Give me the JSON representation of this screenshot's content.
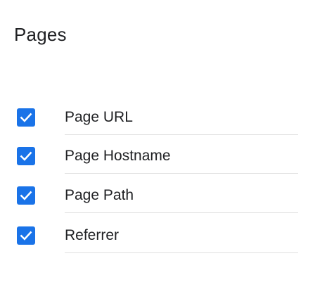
{
  "section": {
    "title": "Pages"
  },
  "fields": [
    {
      "label": "Page URL",
      "checked": true,
      "icon": "check-icon"
    },
    {
      "label": "Page Hostname",
      "checked": true,
      "icon": "check-icon"
    },
    {
      "label": "Page Path",
      "checked": true,
      "icon": "check-icon"
    },
    {
      "label": "Referrer",
      "checked": true,
      "icon": "check-icon"
    }
  ],
  "colors": {
    "checkbox_fill": "#1a73e8",
    "checkmark": "#ffffff",
    "text": "#202124",
    "divider": "#e0e0e0"
  }
}
